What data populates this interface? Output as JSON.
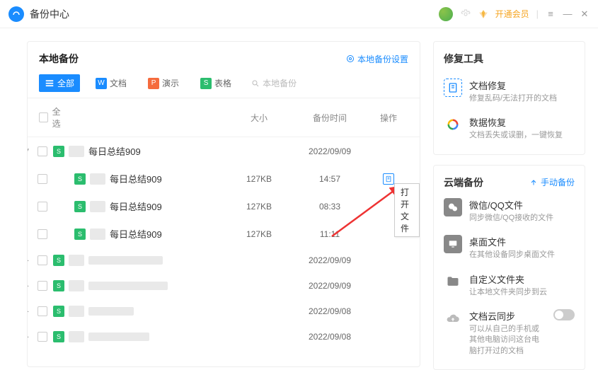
{
  "app": {
    "title": "备份中心"
  },
  "topbar": {
    "vip": "开通会员"
  },
  "local": {
    "title": "本地备份",
    "settings": "本地备份设置",
    "filters": {
      "all": "全部",
      "doc": "文档",
      "ppt": "演示",
      "xls": "表格",
      "search_placeholder": "本地备份"
    },
    "head": {
      "select_all": "全选",
      "size": "大小",
      "time": "备份时间",
      "action": "操作"
    },
    "rows": [
      {
        "expand": "down",
        "name": "每日总结909",
        "size": "",
        "time": "2022/09/09",
        "child": false
      },
      {
        "expand": "",
        "name": "每日总结909",
        "size": "127KB",
        "time": "14:57",
        "child": true,
        "action": true
      },
      {
        "expand": "",
        "name": "每日总结909",
        "size": "127KB",
        "time": "08:33",
        "child": true
      },
      {
        "expand": "",
        "name": "每日总结909",
        "size": "127KB",
        "time": "11:11",
        "child": true
      },
      {
        "expand": "right",
        "name": "",
        "size": "",
        "time": "2022/09/09",
        "child": false,
        "blurred": true
      },
      {
        "expand": "right",
        "name": "",
        "size": "",
        "time": "2022/09/09",
        "child": false,
        "blurred": true
      },
      {
        "expand": "right",
        "name": "",
        "size": "",
        "time": "2022/09/08",
        "child": false,
        "blurred": true
      },
      {
        "expand": "right",
        "name": "",
        "size": "",
        "time": "2022/09/08",
        "child": false,
        "blurred": true
      }
    ],
    "tooltip": "打开文件"
  },
  "repair": {
    "title": "修复工具",
    "items": [
      {
        "title": "文档修复",
        "desc": "修复乱码/无法打开的文档"
      },
      {
        "title": "数据恢复",
        "desc": "文档丢失或误删，一键恢复"
      }
    ]
  },
  "cloud": {
    "title": "云端备份",
    "manual": "手动备份",
    "items": [
      {
        "title": "微信/QQ文件",
        "desc": "同步微信/QQ接收的文件"
      },
      {
        "title": "桌面文件",
        "desc": "在其他设备同步桌面文件"
      },
      {
        "title": "自定义文件夹",
        "desc": "让本地文件夹同步到云"
      },
      {
        "title": "文档云同步",
        "desc": "可以从自己的手机或其他电脑访问这台电脑打开过的文档",
        "switch": true
      }
    ]
  }
}
